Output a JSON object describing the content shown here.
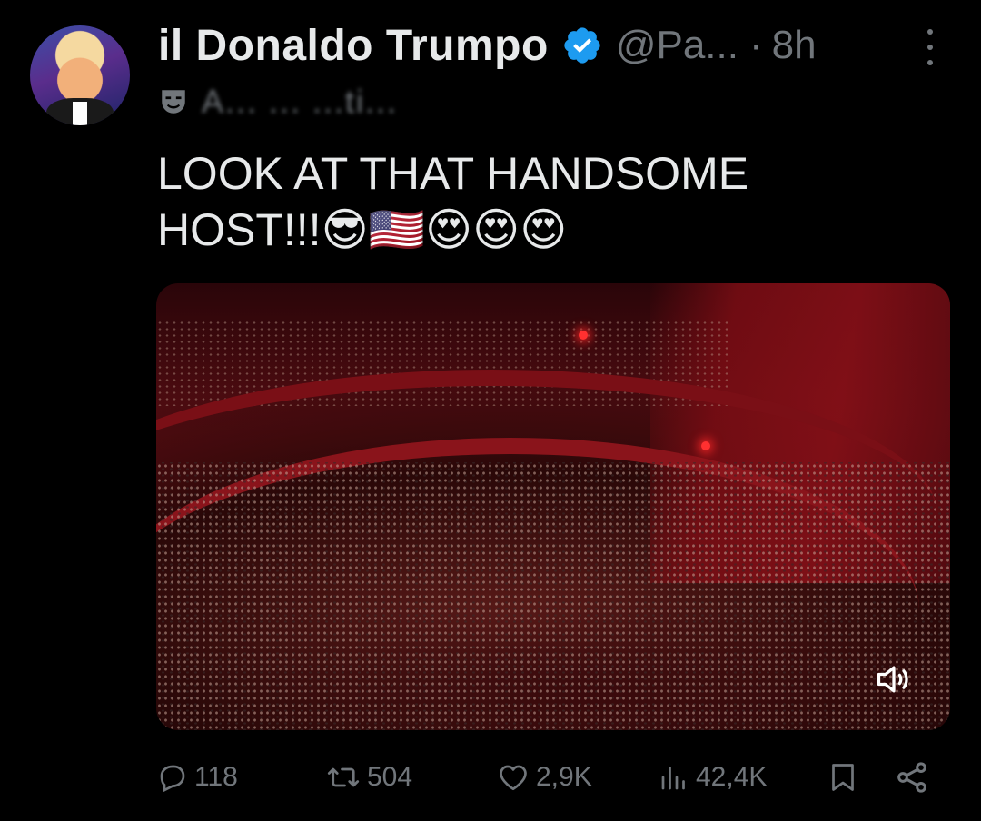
{
  "author": {
    "name": "il Donaldo Trumpo",
    "handle": "@Pa...",
    "separator": "·",
    "time": "8h",
    "subtitle": "A... ... ...ti..."
  },
  "tweet": {
    "text_line1": "LOOK AT THAT HANDSOME",
    "text_line2": "HOST!!!",
    "emojis": "😎🇺🇸😍😍😍"
  },
  "media": {
    "type": "video",
    "description_icon": "speaker-muted-icon"
  },
  "actions": {
    "replies": "118",
    "reposts": "504",
    "likes": "2,9K",
    "views": "42,4K"
  },
  "colors": {
    "background": "#000000",
    "text": "#e7e9ea",
    "muted": "#71767b",
    "verified": "#1d9bf0"
  }
}
